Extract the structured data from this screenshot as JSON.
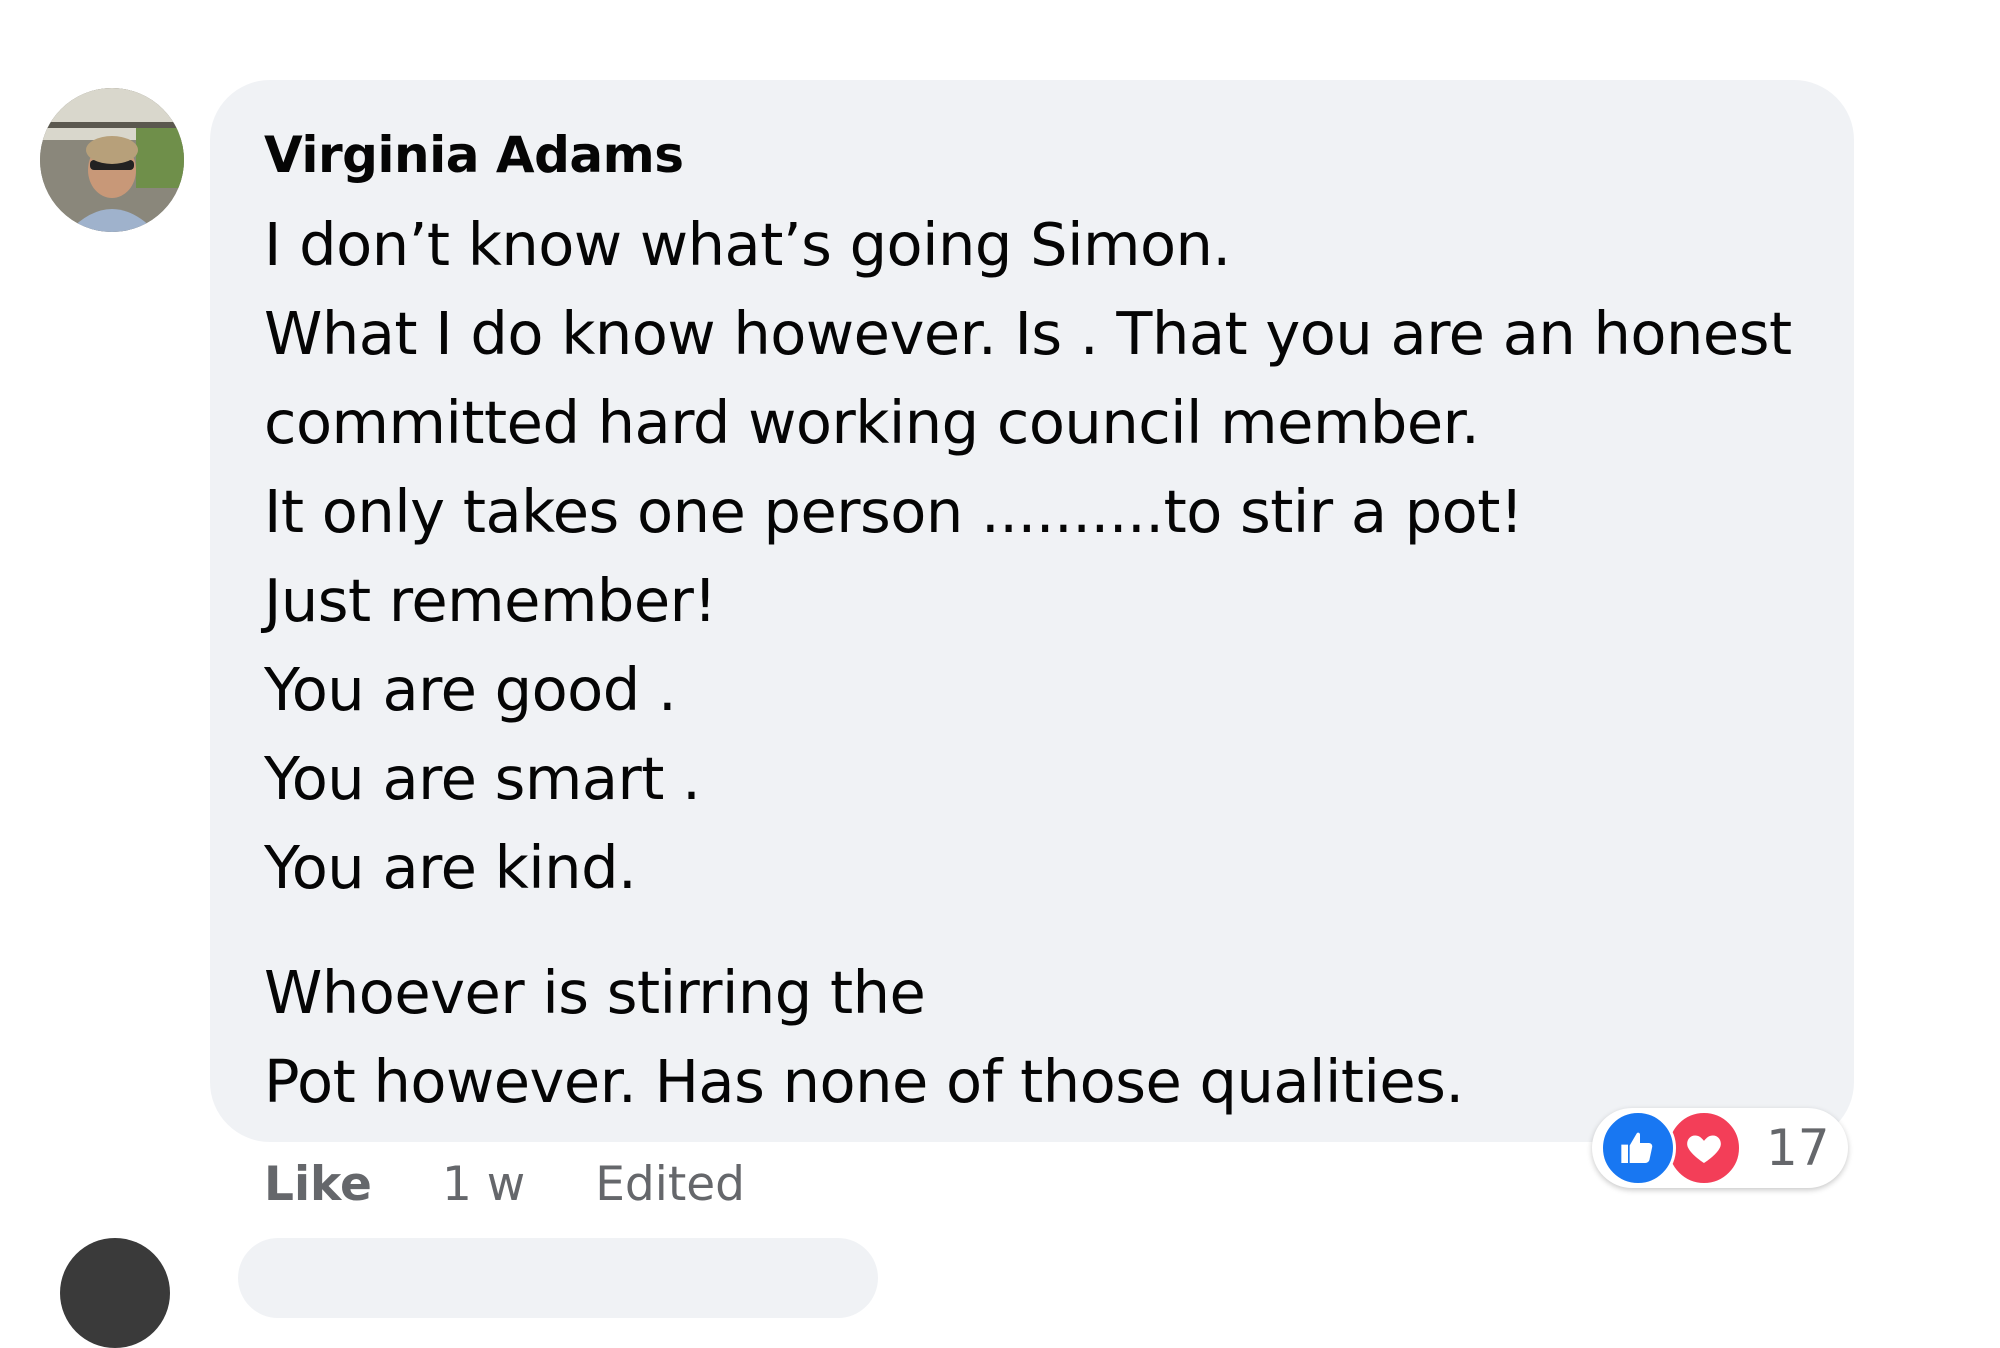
{
  "comment": {
    "author": "Virginia Adams",
    "lines": [
      "I don’t know what’s going Simon.",
      "What I do know however. Is . That you are an honest",
      "committed hard working council member.",
      "It only takes one person ..........to stir a pot!",
      "Just remember!",
      "You are good .",
      "You are smart .",
      "You are kind."
    ],
    "lines_paragraph2": [
      "Whoever is stirring the",
      "Pot however. Has none of those qualities."
    ],
    "actions": {
      "like_label": "Like",
      "timestamp": "1 w",
      "edited_label": "Edited"
    },
    "reactions": {
      "icons": [
        "like-icon",
        "love-icon"
      ],
      "count": "17"
    },
    "colors": {
      "bubble": "#f0f2f5",
      "like_reaction": "#1877f2",
      "love_reaction": "#f33e58",
      "secondary_text": "#65676b"
    }
  }
}
